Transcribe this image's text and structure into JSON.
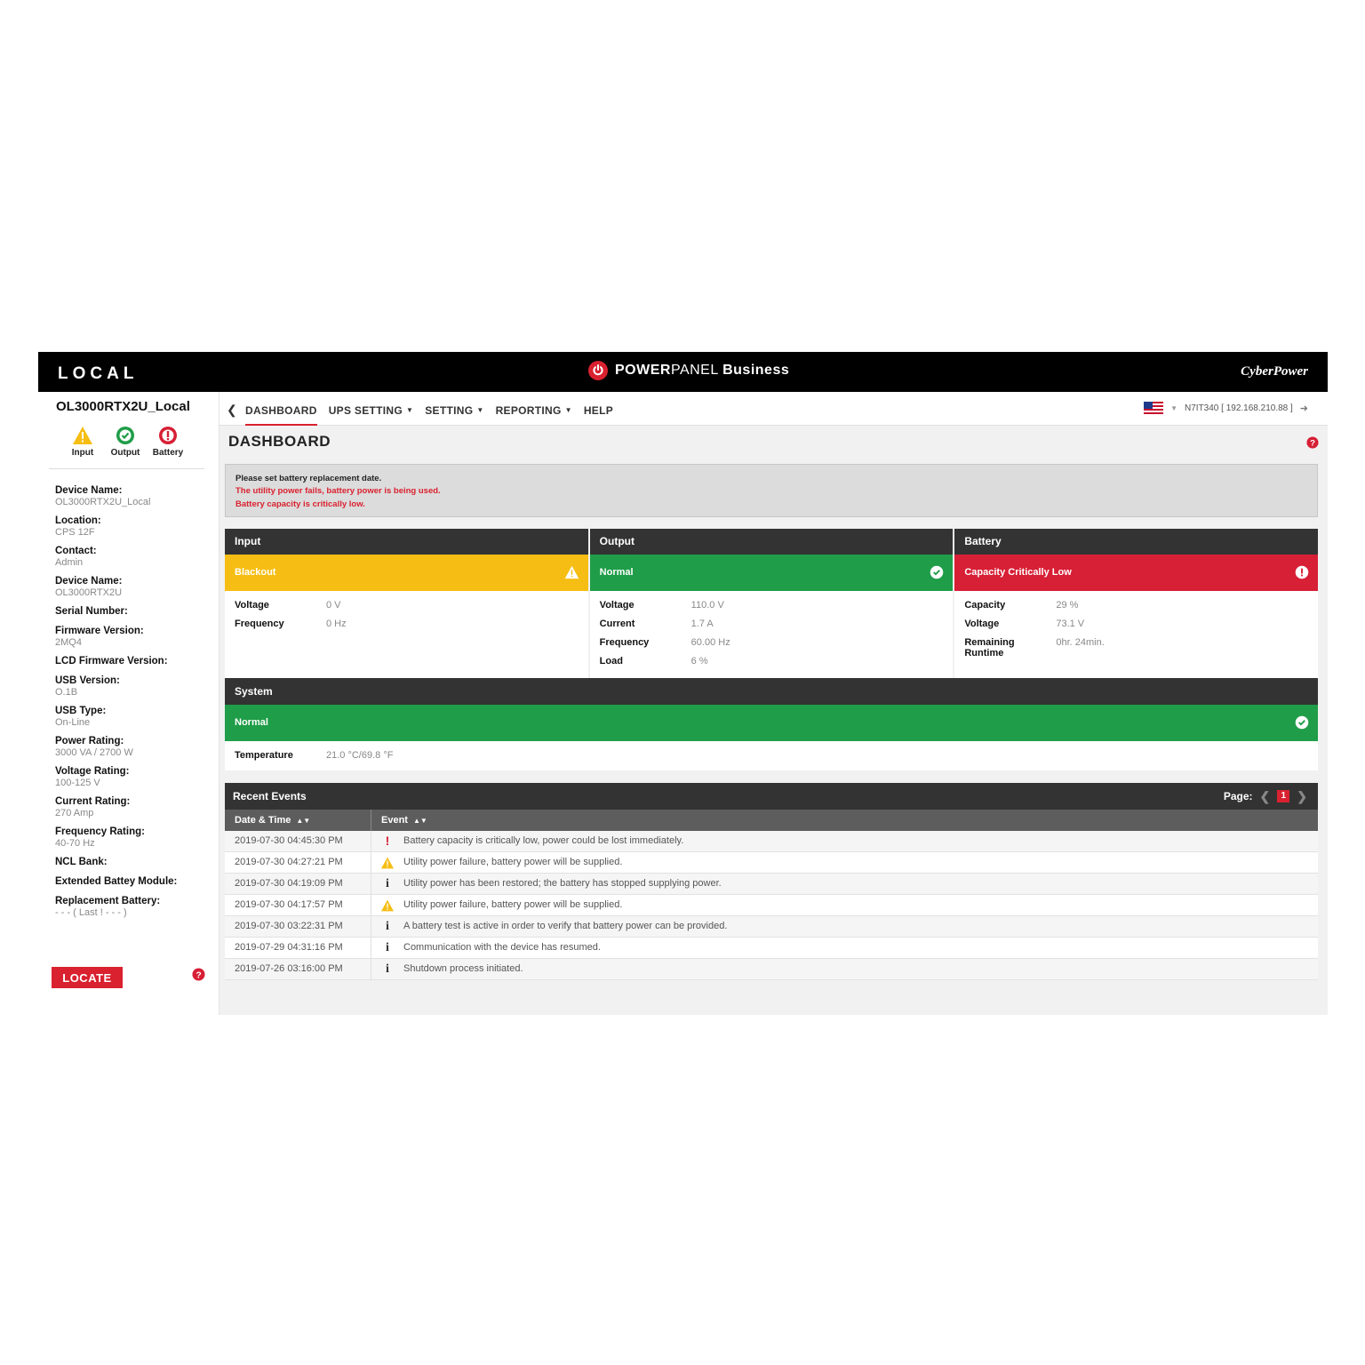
{
  "topbar": {
    "mode": "LOCAL",
    "brand_bold": "POWER",
    "brand_mid": "PANEL",
    "brand_tail": "Business",
    "vendor": "CyberPower"
  },
  "sidebar": {
    "device_title": "OL3000RTX2U_Local",
    "status": [
      {
        "label": "Input",
        "icon": "warning-icon",
        "color": "#f6be14"
      },
      {
        "label": "Output",
        "icon": "check-circle-icon",
        "color": "#1f9d48"
      },
      {
        "label": "Battery",
        "icon": "exclamation-circle-icon",
        "color": "#d71f35"
      }
    ],
    "props": [
      {
        "k": "Device Name:",
        "v": "OL3000RTX2U_Local"
      },
      {
        "k": "Location:",
        "v": "CPS 12F"
      },
      {
        "k": "Contact:",
        "v": "Admin"
      },
      {
        "k": "Device Name:",
        "v": "OL3000RTX2U"
      },
      {
        "k": "Serial Number:",
        "v": ""
      },
      {
        "k": "Firmware Version:",
        "v": "2MQ4"
      },
      {
        "k": "LCD Firmware Version:",
        "v": ""
      },
      {
        "k": "USB Version:",
        "v": "O.1B"
      },
      {
        "k": "USB Type:",
        "v": "On-Line"
      },
      {
        "k": "Power Rating:",
        "v": "3000 VA / 2700 W"
      },
      {
        "k": "Voltage Rating:",
        "v": "100-125 V"
      },
      {
        "k": "Current Rating:",
        "v": "270 Amp"
      },
      {
        "k": "Frequency Rating:",
        "v": "40-70 Hz"
      },
      {
        "k": "NCL Bank:",
        "v": ""
      },
      {
        "k": "Extended Battey Module:",
        "v": ""
      },
      {
        "k": "Replacement Battery:",
        "v": "- - - ( Last ! - - - )"
      }
    ],
    "locate_label": "LOCATE"
  },
  "nav": {
    "items": [
      "DASHBOARD",
      "UPS SETTING",
      "SETTING",
      "REPORTING",
      "HELP"
    ],
    "host": "N7IT340 [ 192.168.210.88 ]"
  },
  "page": {
    "title": "DASHBOARD",
    "alerts": [
      "Please set battery replacement date.",
      "The utility power fails, battery power is being used.",
      "Battery capacity is critically low."
    ]
  },
  "panels": {
    "input": {
      "title": "Input",
      "status": "Blackout",
      "rows": [
        [
          "Voltage",
          "0 V"
        ],
        [
          "Frequency",
          "0 Hz"
        ]
      ]
    },
    "output": {
      "title": "Output",
      "status": "Normal",
      "rows": [
        [
          "Voltage",
          "110.0 V"
        ],
        [
          "Current",
          "1.7 A"
        ],
        [
          "Frequency",
          "60.00 Hz"
        ],
        [
          "Load",
          "6 %"
        ]
      ]
    },
    "battery": {
      "title": "Battery",
      "status": "Capacity Critically Low",
      "rows": [
        [
          "Capacity",
          "29 %"
        ],
        [
          "Voltage",
          "73.1 V"
        ],
        [
          "Remaining Runtime",
          "0hr. 24min."
        ]
      ]
    },
    "system": {
      "title": "System",
      "status": "Normal",
      "rows": [
        [
          "Temperature",
          "21.0 °C/69.8 °F"
        ]
      ]
    }
  },
  "events": {
    "title": "Recent Events",
    "page_label": "Page:",
    "page": "1",
    "columns": [
      "Date & Time",
      "Event"
    ],
    "rows": [
      {
        "time": "2019-07-30 04:45:30 PM",
        "type": "critical",
        "text": "Battery capacity is critically low, power could be lost immediately."
      },
      {
        "time": "2019-07-30 04:27:21 PM",
        "type": "warning",
        "text": "Utility power failure, battery power will be supplied."
      },
      {
        "time": "2019-07-30 04:19:09 PM",
        "type": "info",
        "text": "Utility power has been restored; the battery has stopped supplying power."
      },
      {
        "time": "2019-07-30 04:17:57 PM",
        "type": "warning",
        "text": "Utility power failure, battery power will be supplied."
      },
      {
        "time": "2019-07-30 03:22:31 PM",
        "type": "info",
        "text": "A battery test is active in order to verify that battery power can be provided."
      },
      {
        "time": "2019-07-29 04:31:16 PM",
        "type": "info",
        "text": "Communication with the device has resumed."
      },
      {
        "time": "2019-07-26 03:16:00 PM",
        "type": "info",
        "text": "Shutdown process initiated."
      }
    ]
  }
}
